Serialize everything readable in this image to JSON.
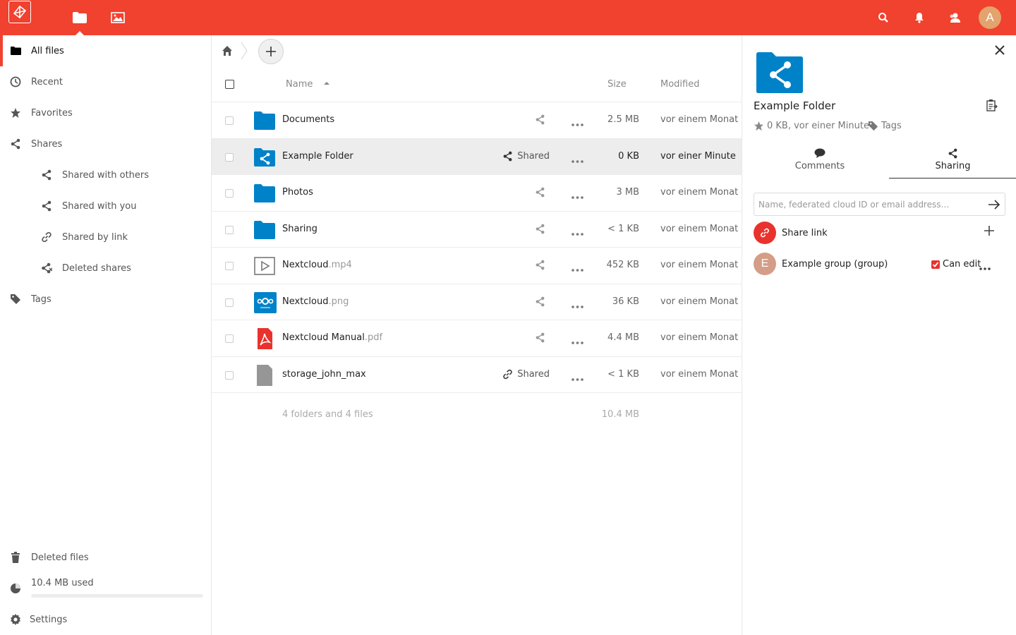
{
  "colors": {
    "brand": "#f1412f",
    "folder": "#0082c9",
    "avatar": "#e3a36c",
    "group_avatar": "#d49d88",
    "pdf": "#e9322d"
  },
  "header": {
    "avatar_letter": "A",
    "apps": [
      "folder-icon",
      "image-icon"
    ],
    "icons": [
      "search-icon",
      "bell-icon",
      "contacts-icon"
    ]
  },
  "sidebar": {
    "items": [
      {
        "label": "All files",
        "icon": "folder-icon"
      },
      {
        "label": "Recent",
        "icon": "clock-icon"
      },
      {
        "label": "Favorites",
        "icon": "star-icon"
      },
      {
        "label": "Shares",
        "icon": "share-icon"
      },
      {
        "label": "Shared with others",
        "icon": "share-icon"
      },
      {
        "label": "Shared with you",
        "icon": "share-icon"
      },
      {
        "label": "Shared by link",
        "icon": "link-icon"
      },
      {
        "label": "Deleted shares",
        "icon": "share-deleted-icon"
      },
      {
        "label": "Tags",
        "icon": "tag-icon"
      }
    ],
    "deleted_files": "Deleted files",
    "quota": "10.4 MB used",
    "quota_fraction": 0.0,
    "settings": "Settings"
  },
  "table": {
    "headers": {
      "name": "Name",
      "size": "Size",
      "modified": "Modified"
    },
    "rows": [
      {
        "name": "Documents",
        "ext": "",
        "type": "folder",
        "share": "",
        "size": "2.5 MB",
        "modified": "vor einem Monat"
      },
      {
        "name": "Example Folder",
        "ext": "",
        "type": "shared-folder",
        "share": "Shared",
        "size": "0 KB",
        "modified": "vor einer Minute"
      },
      {
        "name": "Photos",
        "ext": "",
        "type": "folder",
        "share": "",
        "size": "3 MB",
        "modified": "vor einem Monat"
      },
      {
        "name": "Sharing",
        "ext": "",
        "type": "folder",
        "share": "",
        "size": "< 1 KB",
        "modified": "vor einem Monat"
      },
      {
        "name": "Nextcloud",
        "ext": ".mp4",
        "type": "video",
        "share": "",
        "size": "452 KB",
        "modified": "vor einem Monat"
      },
      {
        "name": "Nextcloud",
        "ext": ".png",
        "type": "image",
        "share": "",
        "size": "36 KB",
        "modified": "vor einem Monat"
      },
      {
        "name": "Nextcloud Manual",
        "ext": ".pdf",
        "type": "pdf",
        "share": "",
        "size": "4.4 MB",
        "modified": "vor einem Monat"
      },
      {
        "name": "storage_john_max",
        "ext": "",
        "type": "file",
        "share": "Shared",
        "size": "< 1 KB",
        "modified": "vor einem Monat"
      }
    ],
    "summary": "4 folders and 4 files",
    "summary_size": "10.4 MB"
  },
  "panel": {
    "title": "Example Folder",
    "meta": "0 KB, vor einer Minute",
    "tags": "Tags",
    "tabs": {
      "comments": "Comments",
      "sharing": "Sharing"
    },
    "share_placeholder": "Name, federated cloud ID or email address…",
    "share_link": "Share link",
    "group_letter": "E",
    "group": "Example group (group)",
    "can_edit": "Can edit"
  }
}
